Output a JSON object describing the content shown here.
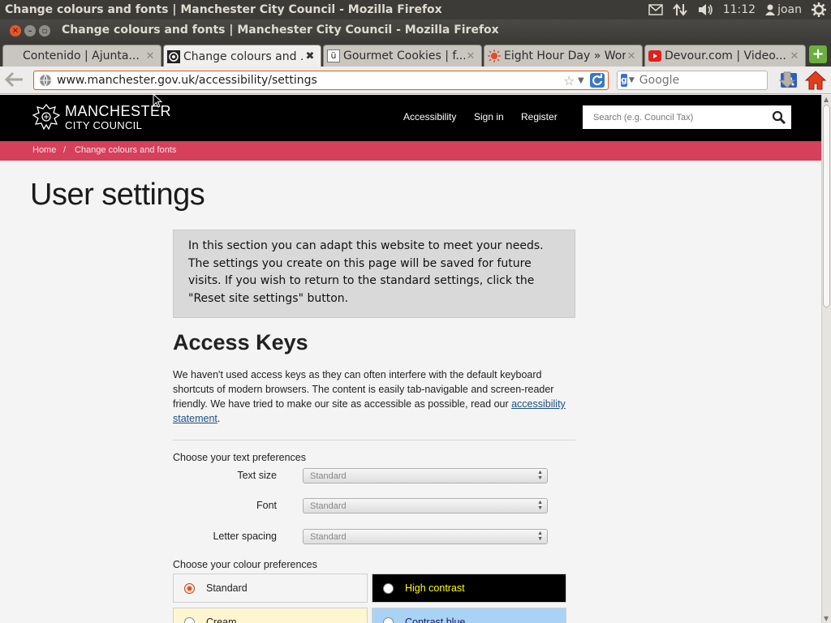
{
  "panel": {
    "app_title": "Change colours and fonts | Manchester City Council - Mozilla Firefox",
    "time": "11:12",
    "user": "joan"
  },
  "window": {
    "title": "Change colours and fonts | Manchester City Council - Mozilla Firefox"
  },
  "tabs": [
    {
      "label": "Contenido | Ajunta...",
      "icon": "page-icon"
    },
    {
      "label": "Change colours and ...",
      "icon": "council-favicon"
    },
    {
      "label": "Gourmet Cookies | f...",
      "icon": "u-favicon"
    },
    {
      "label": "Eight Hour Day » Work",
      "icon": "sun-favicon"
    },
    {
      "label": "Devour.com | Video...",
      "icon": "devour-favicon"
    }
  ],
  "navbar": {
    "url": "www.manchester.gov.uk/accessibility/settings",
    "search_placeholder": "Google",
    "search_engine_letter": "g"
  },
  "site": {
    "logo_line1": "MANCHESTER",
    "logo_line2": "CITY COUNCIL",
    "nav": [
      "Accessibility",
      "Sign in",
      "Register"
    ],
    "search_placeholder": "Search (e.g. Council Tax)",
    "accent": "#d6405a",
    "breadcrumb": {
      "home": "Home",
      "separator": "/",
      "current": "Change colours and fonts"
    }
  },
  "page": {
    "title": "User settings",
    "intro": "In this section you can adapt this website to meet your needs. The settings you create on this page will be saved for future visits. If you wish to return to the standard settings, click the \"Reset site settings\" button.",
    "access_keys_heading": "Access Keys",
    "access_keys_text": "We haven't used access keys as they can often interfere with the default keyboard shortcuts of modern browsers. The content is easily tab-navigable and screen-reader friendly. We have tried to make our site as accessible as possible, read our ",
    "access_keys_link": "accessibility statement",
    "access_keys_end": ".",
    "text_prefs_label": "Choose your text preferences",
    "text_size_label": "Text size",
    "text_size_value": "Standard",
    "font_label": "Font",
    "font_value": "Standard",
    "letter_spacing_label": "Letter spacing",
    "letter_spacing_value": "Standard",
    "colour_prefs_label": "Choose your colour preferences",
    "colour_options": [
      {
        "label": "Standard",
        "checked": true,
        "bg": "#f4f4f4",
        "fg": "#222222"
      },
      {
        "label": "High contrast",
        "checked": false,
        "bg": "#000000",
        "fg": "#ffff00"
      },
      {
        "label": "Cream",
        "checked": false,
        "bg": "#fdf6d0",
        "fg": "#222222"
      },
      {
        "label": "Contrast blue",
        "checked": false,
        "bg": "#a9d3f5",
        "fg": "#1a1a6e"
      }
    ]
  }
}
